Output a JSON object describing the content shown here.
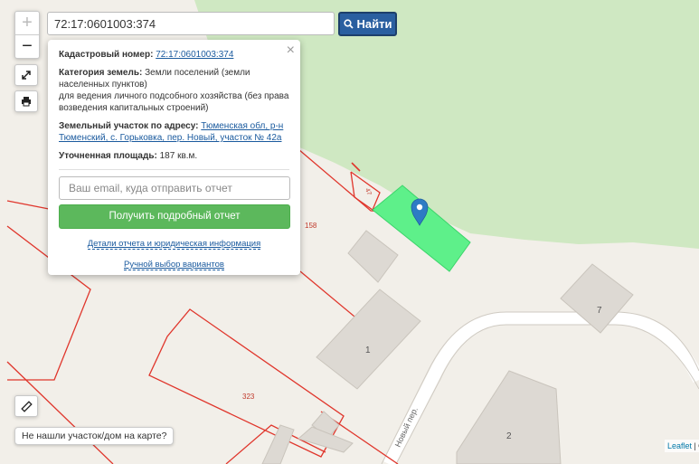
{
  "search": {
    "value": "72:17:0601003:374",
    "button_label": "Найти"
  },
  "map_controls": {
    "zoom_in": "+",
    "zoom_out": "−"
  },
  "popup": {
    "close": "×",
    "cadastral_label": "Кадастровый номер:",
    "cadastral_number": "72:17:0601003:374",
    "category_label": "Категория земель:",
    "category_value": "Земли поселений (земли населенных пунктов)",
    "purpose": "для ведения личного подсобного хозяйства (без права возведения капитальных строений)",
    "address_label": "Земельный участок по адресу:",
    "address_value": "Тюменская обл, р-н Тюменский, с. Горьковка, пер. Новый, участок № 42а",
    "area_label": "Уточненная площадь:",
    "area_value": "187 кв.м.",
    "email_placeholder": "Ваш email, куда отправить отчет",
    "report_button": "Получить подробный отчет",
    "details_link": "Детали отчета и юридическая информация",
    "manual_link": "Ручной выбор вариантов"
  },
  "map_labels": {
    "parcel_158": "158",
    "parcel_323": "323",
    "parcel_47": "47",
    "house_1": "1",
    "house_2": "2",
    "house_7": "7",
    "street": "Новый пер."
  },
  "colors": {
    "background": "#f2efe9",
    "forest": "#cfe8c2",
    "building": "#ddd9d3",
    "parcel_border": "#e0362c",
    "selected_parcel": "#5ef08a",
    "marker": "#2d7bc4",
    "search_button": "#2a5fa0",
    "report_button": "#5cb85c"
  },
  "not_found_button": "Не нашли участок/дом на карте?",
  "attribution": {
    "leaflet": "Leaflet",
    "separator": " | ©"
  }
}
